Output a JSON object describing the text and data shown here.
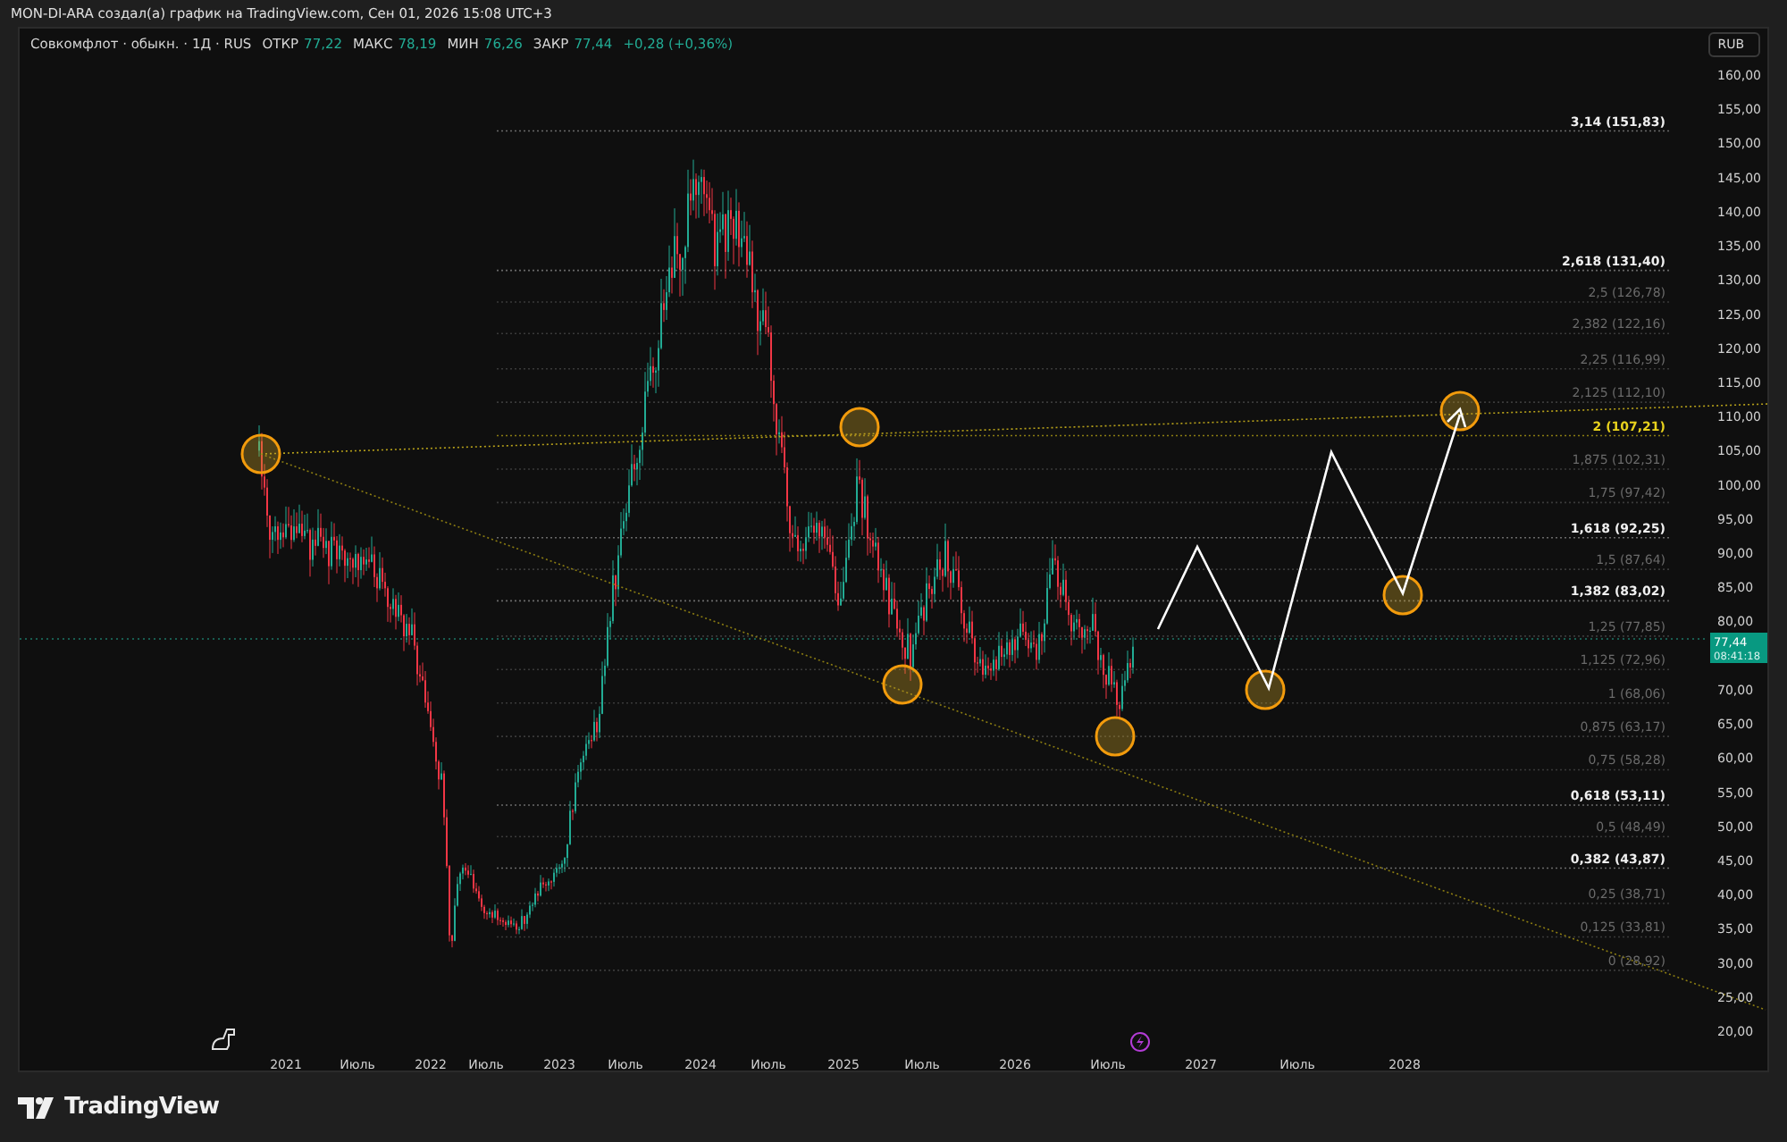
{
  "header": {
    "title": "MON-DI-ARA создал(а) график на TradingView.com, Сен 01, 2026 15:08 UTC+3"
  },
  "legend": {
    "symbol": "Совкомфлот · обыкн. · 1Д · RUS",
    "fields": [
      {
        "label": "ОТКР",
        "value": "77,22"
      },
      {
        "label": "МАКС",
        "value": "78,19"
      },
      {
        "label": "МИН",
        "value": "76,26"
      },
      {
        "label": "ЗАКР",
        "value": "77,44"
      }
    ],
    "change": "+0,28 (+0,36%)"
  },
  "price_axis": {
    "currency": "RUB",
    "labels": [
      "160,00",
      "155,00",
      "150,00",
      "145,00",
      "140,00",
      "135,00",
      "130,00",
      "125,00",
      "120,00",
      "115,00",
      "110,00",
      "105,00",
      "100,00",
      "95,00",
      "90,00",
      "85,00",
      "80,00"
    ],
    "labels_below": [
      "70,00",
      "65,00",
      "60,00",
      "55,00",
      "50,00",
      "45,00",
      "40,00",
      "35,00",
      "30,00",
      "25,00",
      "20,00"
    ],
    "last_price": {
      "value": "77,44",
      "time": "08:41:18"
    }
  },
  "time_axis": {
    "labels": [
      "2021",
      "Июль",
      "2022",
      "Июль",
      "2023",
      "Июль",
      "2024",
      "Июль",
      "2025",
      "Июль",
      "2026",
      "Июль",
      "2027",
      "Июль",
      "2028"
    ]
  },
  "fib_levels": [
    {
      "label": "3,14 (151,83)",
      "kind": "key"
    },
    {
      "label": "2,618 (131,40)",
      "kind": "key"
    },
    {
      "label": "2,5 (126,78)",
      "kind": "minor"
    },
    {
      "label": "2,382 (122,16)",
      "kind": "minor"
    },
    {
      "label": "2,25 (116,99)",
      "kind": "minor"
    },
    {
      "label": "2,125 (112,10)",
      "kind": "minor"
    },
    {
      "label": "2 (107,21)",
      "kind": "target"
    },
    {
      "label": "1,875 (102,31)",
      "kind": "minor"
    },
    {
      "label": "1,75 (97,42)",
      "kind": "minor"
    },
    {
      "label": "1,618 (92,25)",
      "kind": "key"
    },
    {
      "label": "1,5 (87,64)",
      "kind": "minor"
    },
    {
      "label": "1,382 (83,02)",
      "kind": "key"
    },
    {
      "label": "1,25 (77,85)",
      "kind": "minor"
    },
    {
      "label": "1,125 (72,96)",
      "kind": "minor"
    },
    {
      "label": "1 (68,06)",
      "kind": "minor"
    },
    {
      "label": "0,875 (63,17)",
      "kind": "minor"
    },
    {
      "label": "0,75 (58,28)",
      "kind": "minor"
    },
    {
      "label": "0,618 (53,11)",
      "kind": "key"
    },
    {
      "label": "0,5 (48,49)",
      "kind": "minor"
    },
    {
      "label": "0,382 (43,87)",
      "kind": "key"
    },
    {
      "label": "0,25 (38,71)",
      "kind": "minor"
    },
    {
      "label": "0,125 (33,81)",
      "kind": "minor"
    },
    {
      "label": "0 (28,92)",
      "kind": "minor"
    }
  ],
  "footer": {
    "brand": "TradingView"
  }
}
